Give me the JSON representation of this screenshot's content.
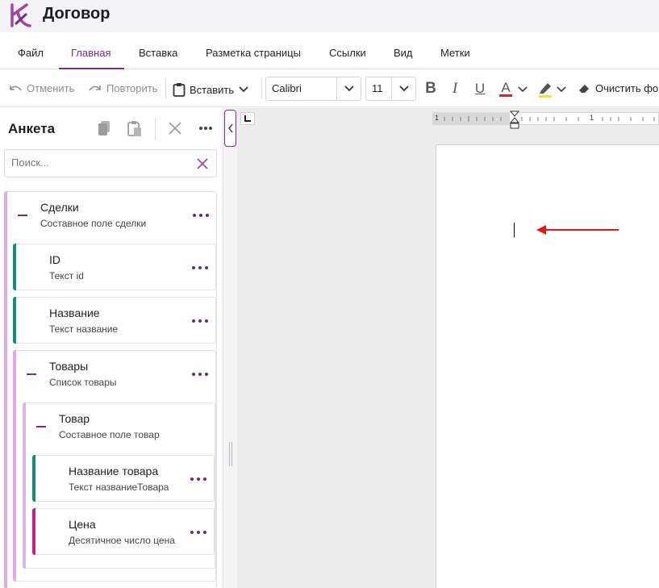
{
  "app": {
    "title": "Договор",
    "accent": "#7a2c84"
  },
  "menu": {
    "tabs": [
      {
        "label": "Файл",
        "active": false
      },
      {
        "label": "Главная",
        "active": true
      },
      {
        "label": "Вставка",
        "active": false
      },
      {
        "label": "Разметка страницы",
        "active": false
      },
      {
        "label": "Ссылки",
        "active": false
      },
      {
        "label": "Вид",
        "active": false
      },
      {
        "label": "Метки",
        "active": false
      }
    ]
  },
  "toolbar": {
    "undo_label": "Отменить",
    "redo_label": "Повторить",
    "paste_label": "Вставить",
    "font_family": "Calibri",
    "font_size": "11",
    "bold_glyph": "B",
    "italic_glyph": "I",
    "underline_glyph": "U",
    "font_color_glyph": "A",
    "font_color": "#e02020",
    "highlight_color": "#f5e03a",
    "clear_format_label": "Очистить фо"
  },
  "panel": {
    "title": "Анкета",
    "search_placeholder": "Поиск...",
    "nodes": [
      {
        "label": "Сделки",
        "type": "Составное поле",
        "key": "сделки",
        "bar_color": "#e6a8e6"
      },
      {
        "label": "ID",
        "type": "Текст",
        "key": "id",
        "bar_color": "#1a8a78"
      },
      {
        "label": "Название",
        "type": "Текст",
        "key": "название",
        "bar_color": "#1a8a78"
      },
      {
        "label": "Товары",
        "type": "Список",
        "key": "товары",
        "bar_color": "#e6a8e6"
      },
      {
        "label": "Товар",
        "type": "Составное поле",
        "key": "товар",
        "bar_color": "#e0b4e6"
      },
      {
        "label": "Название товара",
        "type": "Текст",
        "key": "названиеТовара",
        "bar_color": "#1a8a78"
      },
      {
        "label": "Цена",
        "type": "Десятичное число",
        "key": "цена",
        "bar_color": "#c0208a"
      }
    ]
  },
  "ruler": {
    "left_number": "1",
    "right_number": "1"
  },
  "annotation": {
    "arrow_color": "#e01818"
  }
}
